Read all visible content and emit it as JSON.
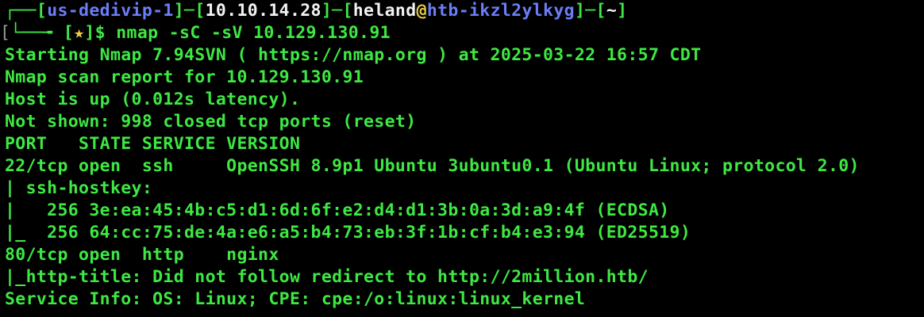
{
  "prompt": {
    "box_top": "┌──",
    "open": "[",
    "close": "]",
    "sep": "─",
    "tail": "─",
    "host_tag": "us-dedivip-1",
    "ip": "10.10.14.28",
    "user": "heland",
    "at": "@",
    "machine": "htb-ikzl2ylkyg",
    "cwd": "~",
    "box_bottom": "└──╼ ",
    "left_bracket_char": "[",
    "star_open": "[",
    "star": "★",
    "star_close": "]",
    "dollar": "$ ",
    "command": "nmap -sC -sV 10.129.130.91"
  },
  "output": [
    "Starting Nmap 7.94SVN ( https://nmap.org ) at 2025-03-22 16:57 CDT",
    "Nmap scan report for 10.129.130.91",
    "Host is up (0.012s latency).",
    "Not shown: 998 closed tcp ports (reset)",
    "PORT   STATE SERVICE VERSION",
    "22/tcp open  ssh     OpenSSH 8.9p1 Ubuntu 3ubuntu0.1 (Ubuntu Linux; protocol 2.0)",
    "| ssh-hostkey:",
    "|   256 3e:ea:45:4b:c5:d1:6d:6f:e2:d4:d1:3b:0a:3d:a9:4f (ECDSA)",
    "|_  256 64:cc:75:de:4a:e6:a5:b4:73:eb:3f:1b:cf:b4:e3:94 (ED25519)",
    "80/tcp open  http    nginx",
    "|_http-title: Did not follow redirect to http://2million.htb/",
    "Service Info: OS: Linux; CPE: cpe:/o:linux:linux_kernel"
  ],
  "colors": {
    "background": "#000000",
    "prompt_green": "#3ee843",
    "hostname_blue": "#6b7ef7",
    "text_white": "#f2f2f2",
    "star_yellow": "#e8d044"
  }
}
